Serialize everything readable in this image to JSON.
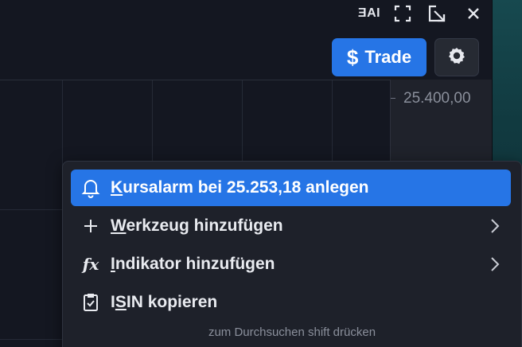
{
  "window_controls": {
    "ai_label": "ƎAI",
    "expand_icon": "fullscreen-icon",
    "popout_icon": "popout-icon",
    "close_icon": "close-icon"
  },
  "toolbar": {
    "trade_icon": "$",
    "trade_label": "Trade",
    "settings_icon": "gear-icon",
    "accent_color": "#2675e6"
  },
  "price_axis": {
    "label": "25.400,00"
  },
  "context_menu": {
    "items": [
      {
        "mnemonic": "K",
        "rest": "ursalarm bei 25.253,18 anlegen",
        "icon": "bell-icon",
        "active": true
      },
      {
        "mnemonic": "W",
        "rest": "erkzeug hinzufügen",
        "icon": "plus-icon",
        "submenu": true
      },
      {
        "mnemonic": "I",
        "rest": "ndikator hinzufügen",
        "icon": "fx-icon",
        "icon_text": "fx",
        "submenu": true
      },
      {
        "prefix": "I",
        "mnemonic": "S",
        "rest": "IN kopieren",
        "icon": "clipboard-check-icon"
      }
    ],
    "hint": "zum Durchsuchen shift drücken"
  }
}
